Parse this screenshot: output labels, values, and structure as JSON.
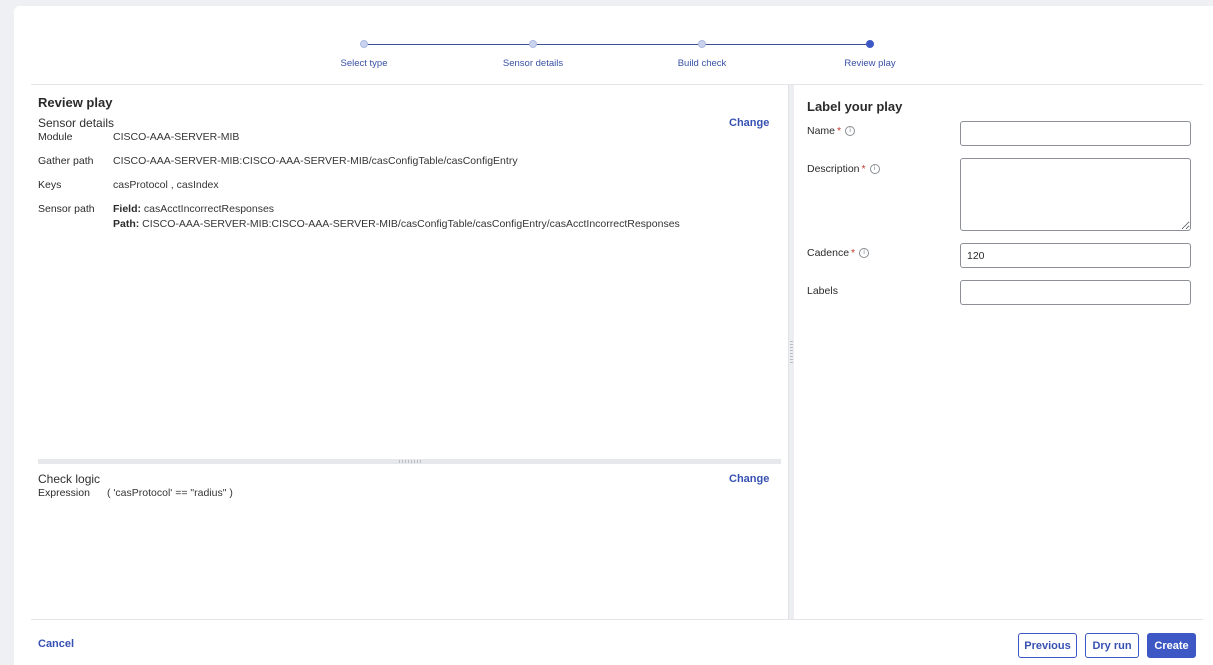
{
  "stepper": {
    "steps": [
      {
        "label": "Select type",
        "active": false
      },
      {
        "label": "Sensor details",
        "active": false
      },
      {
        "label": "Build check",
        "active": false
      },
      {
        "label": "Review play",
        "active": true
      }
    ]
  },
  "review": {
    "title": "Review play",
    "sensor_details": {
      "heading": "Sensor details",
      "change_label": "Change",
      "rows": {
        "module": {
          "label": "Module",
          "value": "CISCO-AAA-SERVER-MIB"
        },
        "gather_path": {
          "label": "Gather path",
          "value": "CISCO-AAA-SERVER-MIB:CISCO-AAA-SERVER-MIB/casConfigTable/casConfigEntry"
        },
        "keys": {
          "label": "Keys",
          "value": "casProtocol , casIndex"
        },
        "sensor_path": {
          "label": "Sensor path",
          "field_label": "Field:",
          "field_value": " casAcctIncorrectResponses",
          "path_label": "Path:",
          "path_value": " CISCO-AAA-SERVER-MIB:CISCO-AAA-SERVER-MIB/casConfigTable/casConfigEntry/casAcctIncorrectResponses"
        }
      }
    },
    "check_logic": {
      "heading": "Check logic",
      "change_label": "Change",
      "expression_label": "Expression",
      "expression_value": "( 'casProtocol' == \"radius\" )"
    }
  },
  "form": {
    "title": "Label your play",
    "name": {
      "label": "Name",
      "required": "*",
      "value": ""
    },
    "description": {
      "label": "Description",
      "required": "*",
      "value": ""
    },
    "cadence": {
      "label": "Cadence",
      "required": "*",
      "value": "120"
    },
    "labels": {
      "label": "Labels",
      "value": ""
    },
    "info_icon_glyph": "i"
  },
  "footer": {
    "cancel_label": "Cancel",
    "previous_label": "Previous",
    "dry_run_label": "Dry run",
    "create_label": "Create"
  },
  "colors": {
    "accent": "#3d58c4",
    "link": "#3751b3",
    "required": "#c0392b"
  }
}
